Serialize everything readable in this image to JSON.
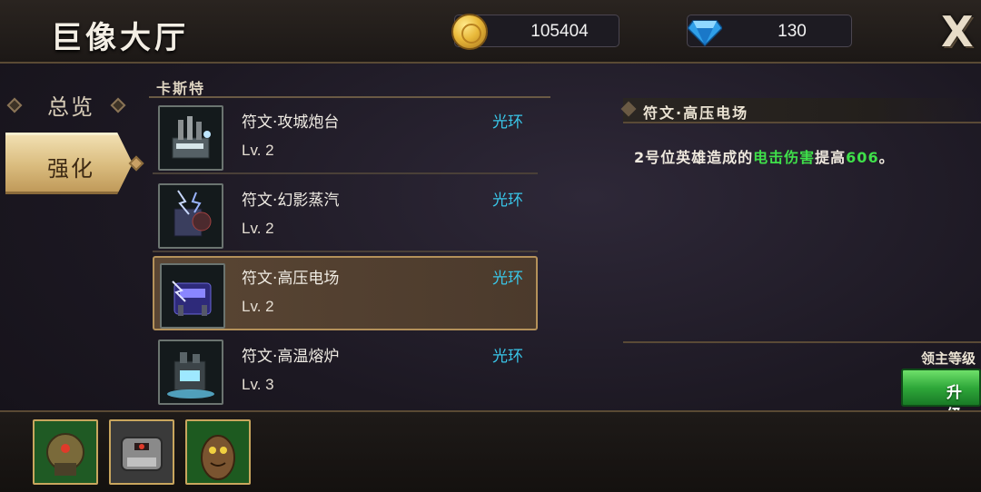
{
  "header": {
    "title": "巨像大厅",
    "gold": "105404",
    "gems": "130",
    "close_label": "X"
  },
  "sidebar": {
    "items": [
      {
        "label": "总览",
        "active": false
      },
      {
        "label": "强化",
        "active": true
      }
    ]
  },
  "rune_list": {
    "title": "卡斯特",
    "items": [
      {
        "name": "符文·攻城炮台",
        "type": "光环",
        "level": "Lv. 2",
        "selected": false,
        "icon": "siege-turret-icon"
      },
      {
        "name": "符文·幻影蒸汽",
        "type": "光环",
        "level": "Lv. 2",
        "selected": false,
        "icon": "phantom-steam-icon"
      },
      {
        "name": "符文·高压电场",
        "type": "光环",
        "level": "Lv. 2",
        "selected": true,
        "icon": "high-voltage-icon"
      },
      {
        "name": "符文·高温熔炉",
        "type": "光环",
        "level": "Lv. 3",
        "selected": false,
        "icon": "furnace-icon"
      }
    ]
  },
  "detail": {
    "title": "符文·高压电场",
    "desc_prefix": "2号位英雄造成的",
    "desc_highlight": "电击伤害",
    "desc_mid": "提高",
    "desc_value": "606",
    "desc_suffix": "。",
    "lord_level_label": "领主等级",
    "upgrade_label": "升级"
  },
  "colors": {
    "accent_gold": "#c9a65e",
    "aura_cyan": "#39c6e8",
    "highlight_green": "#3fe04a",
    "upgrade_green": "#2fa83a"
  },
  "heroes": [
    {
      "icon": "green-mech-hero-icon"
    },
    {
      "icon": "iron-mech-hero-icon"
    },
    {
      "icon": "treant-hero-icon"
    }
  ]
}
